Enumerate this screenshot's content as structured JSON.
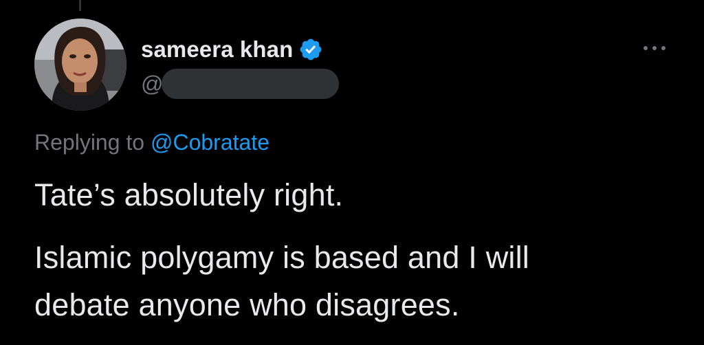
{
  "tweet": {
    "author": {
      "display_name": "sameera khan",
      "handle_prefix": "@",
      "verified": true,
      "verified_color": "#1d9bf0",
      "avatar_icon": "profile-photo"
    },
    "more_icon": "ellipsis-icon",
    "reply": {
      "prefix": "Replying to",
      "mention": "@Cobratate"
    },
    "text_lines": [
      "Tate’s absolutely right.",
      "Islamic polygamy is based and I will",
      "debate anyone who disagrees."
    ]
  },
  "theme": {
    "background": "#000000",
    "primary_text": "#e7e9ea",
    "secondary_text": "#71767b",
    "accent": "#1d9bf0"
  }
}
